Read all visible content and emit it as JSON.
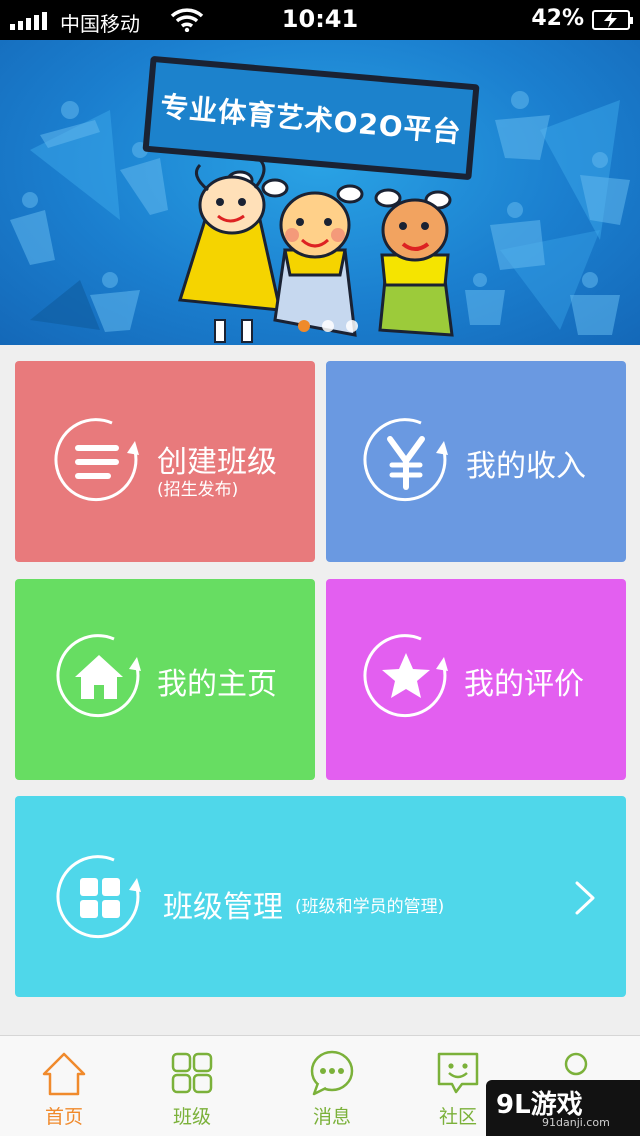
{
  "status_bar": {
    "carrier": "中国移动",
    "time": "10:41",
    "battery": "42%"
  },
  "banner": {
    "slogan": "专业体育艺术O2O平台",
    "page_count": 3,
    "active_page": 1
  },
  "tiles": {
    "create_class": {
      "title": "创建班级",
      "subtitle": "(招生发布)",
      "color": "#e87a7c",
      "icon": "list-icon"
    },
    "my_income": {
      "title": "我的收入",
      "color": "#6a99e1",
      "icon": "yen-icon"
    },
    "my_home": {
      "title": "我的主页",
      "color": "#67dd62",
      "icon": "house-icon"
    },
    "my_review": {
      "title": "我的评价",
      "color": "#e35ff0",
      "icon": "star-icon"
    },
    "class_manage": {
      "title": "班级管理",
      "subtitle": "(班级和学员的管理)",
      "color": "#4fd7ea",
      "icon": "grid-icon"
    }
  },
  "tabbar": {
    "tabs": [
      {
        "label": "首页",
        "icon": "home-icon",
        "active": true
      },
      {
        "label": "班级",
        "icon": "grid-icon"
      },
      {
        "label": "消息",
        "icon": "chat-bubble-icon"
      },
      {
        "label": "社区",
        "icon": "smile-message-icon"
      },
      {
        "label": "",
        "icon": "person-icon"
      }
    ],
    "active_color": "#f08a2c",
    "inactive_color": "#7bb13a"
  },
  "watermark": {
    "brand": "9L游戏",
    "domain": "91danji.com"
  }
}
